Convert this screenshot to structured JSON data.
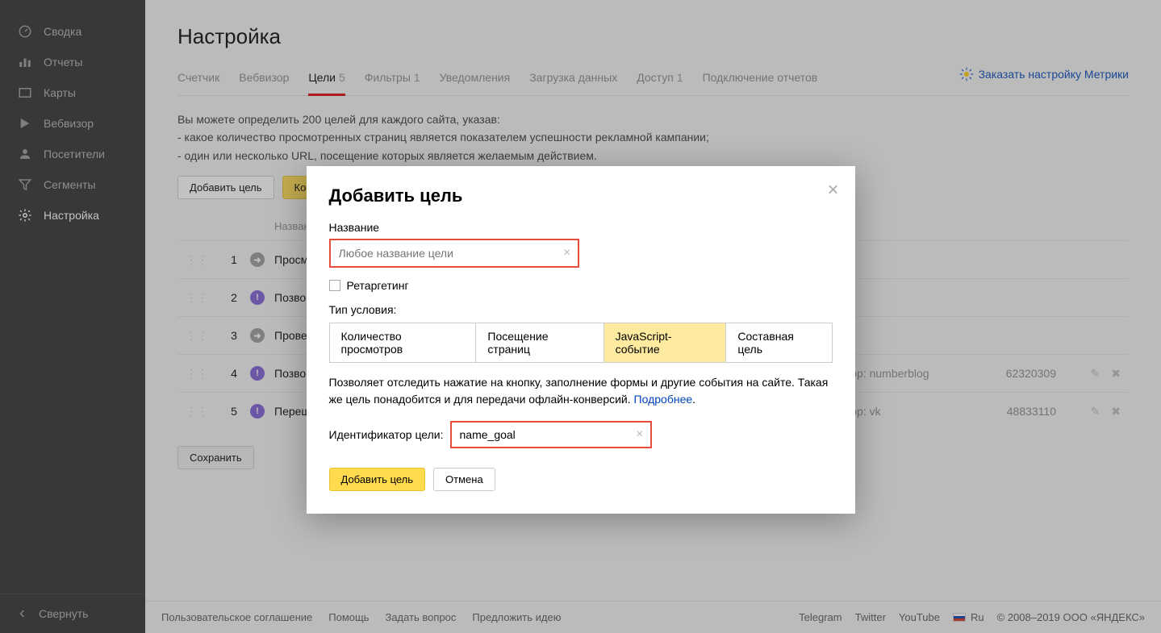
{
  "sidebar": {
    "items": [
      {
        "label": "Сводка"
      },
      {
        "label": "Отчеты"
      },
      {
        "label": "Карты"
      },
      {
        "label": "Вебвизор"
      },
      {
        "label": "Посетители"
      },
      {
        "label": "Сегменты"
      },
      {
        "label": "Настройка"
      }
    ],
    "collapse": "Свернуть"
  },
  "page": {
    "title": "Настройка",
    "order_link": "Заказать настройку Метрики"
  },
  "tabs": [
    {
      "label": "Счетчик",
      "count": ""
    },
    {
      "label": "Вебвизор",
      "count": ""
    },
    {
      "label": "Цели",
      "count": "5"
    },
    {
      "label": "Фильтры",
      "count": "1"
    },
    {
      "label": "Уведомления",
      "count": ""
    },
    {
      "label": "Загрузка данных",
      "count": ""
    },
    {
      "label": "Доступ",
      "count": "1"
    },
    {
      "label": "Подключение отчетов",
      "count": ""
    }
  ],
  "desc": {
    "line1": "Вы можете определить 200 целей для каждого сайта, указав:",
    "line2": "-  какое количество просмотренных страниц является показателем успешности рекламной кампании;",
    "line3": "-  один или несколько URL, посещение которых является желаемым действием."
  },
  "toolbar": {
    "add_goal": "Добавить цель",
    "conv_label": "Конве"
  },
  "table": {
    "header_name": "Название ц",
    "rows": [
      {
        "num": "1",
        "icon": "grey",
        "name": "Просмотре",
        "idtext": "",
        "number": ""
      },
      {
        "num": "2",
        "icon": "purple",
        "name": "Позвонили с",
        "idtext": "",
        "number": ""
      },
      {
        "num": "3",
        "icon": "grey",
        "name": "Проверка на",
        "idtext": "",
        "number": ""
      },
      {
        "num": "4",
        "icon": "purple",
        "name": "Позвонили с блога",
        "idtext": "идентификатор: numberblog",
        "number": "62320309"
      },
      {
        "num": "5",
        "icon": "purple",
        "name": "Перешли в наш VK",
        "idtext": "идентификатор: vk",
        "number": "48833110"
      }
    ]
  },
  "save": "Сохранить",
  "footer": {
    "links": [
      "Пользовательское соглашение",
      "Помощь",
      "Задать вопрос",
      "Предложить идею"
    ],
    "social": [
      "Telegram",
      "Twitter",
      "YouTube"
    ],
    "lang": "Ru",
    "copyright": "© 2008–2019  ООО «",
    "yandex": "ЯНДЕКС",
    "suffix": "»"
  },
  "modal": {
    "title": "Добавить цель",
    "name_label": "Название",
    "name_placeholder": "Любое название цели",
    "retarget": "Ретаргетинг",
    "cond_label": "Тип условия:",
    "cond_tabs": [
      "Количество просмотров",
      "Посещение страниц",
      "JavaScript-событие",
      "Составная цель"
    ],
    "cond_desc_1": "Позволяет отследить нажатие на кнопку, заполнение формы и другие события на сайте. Такая же цель понадобится и для передачи офлайн-конверсий. ",
    "cond_desc_link": "Подробнее",
    "cond_desc_2": ".",
    "id_label": "Идентификатор цели:",
    "id_value": "name_goal",
    "submit": "Добавить цель",
    "cancel": "Отмена"
  }
}
